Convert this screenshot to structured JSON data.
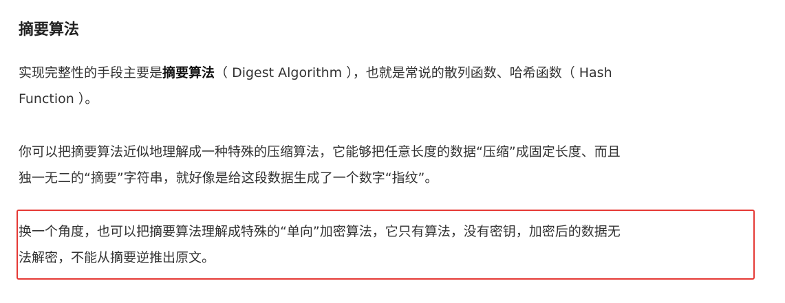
{
  "title": "摘要算法",
  "paragraph1": {
    "lead": "实现完整性的手段主要是",
    "bold": "摘要算法",
    "rest_line1": "（ Digest Algorithm ），也就是常说的散列函数、哈希函数（ Hash",
    "line2": "Function ）。"
  },
  "paragraph2": {
    "line1": "你可以把摘要算法近似地理解成一种特殊的压缩算法，它能够把任意长度的数据“压缩”成固定长度、而且",
    "line2": "独一无二的“摘要”字符串，就好像是给这段数据生成了一个数字“指纹”。"
  },
  "paragraph3": {
    "line1": "换一个角度，也可以把摘要算法理解成特殊的“单向”加密算法，它只有算法，没有密钥，加密后的数据无",
    "line2": "法解密，不能从摘要逆推出原文。"
  },
  "highlight_color": "#e53935"
}
